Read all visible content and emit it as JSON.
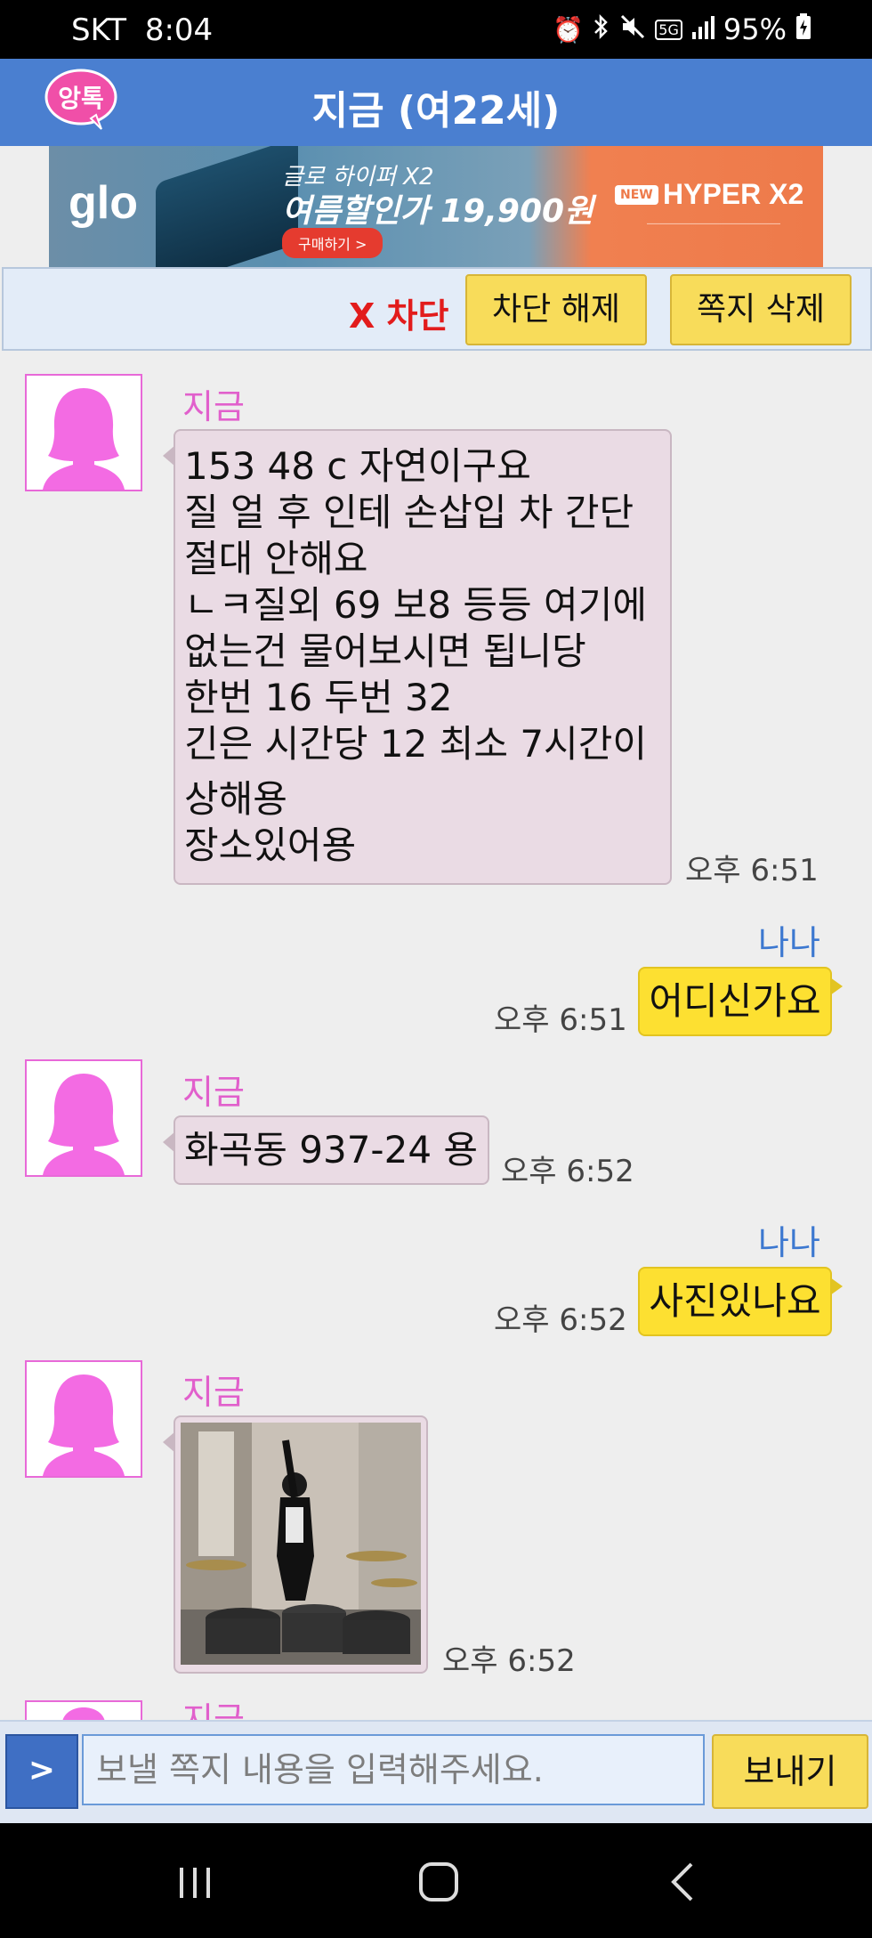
{
  "status_bar": {
    "carrier": "SKT",
    "time": "8:04",
    "network": "5G",
    "battery": "95%",
    "icons": [
      "alarm-icon",
      "bluetooth-icon",
      "mute-icon",
      "network-5g-icon",
      "signal-icon",
      "battery-charging-icon"
    ]
  },
  "header": {
    "logo_text": "앙톡",
    "title": "지금 (여22세)"
  },
  "ad": {
    "brand_logo": "glo",
    "line1": "글로 하이퍼 X2",
    "line2": "여름할인가 19,900원",
    "cta": "구매하기 >",
    "badge": "NEW",
    "product": "HYPER X2"
  },
  "actions": {
    "block": "X 차단",
    "unblock": "차단 해제",
    "delete": "쪽지 삭제"
  },
  "messages": [
    {
      "direction": "in",
      "sender": "지금",
      "lines": [
        "153 48 c 자연이구요",
        "질 얼 후 인테 손삽입 차 간단",
        "절대 안해요",
        "ㄴㅋ질외 69 보8 등등 여기에",
        "없는건 물어보시면 됩니당",
        "한번 16 두번 32",
        "긴은 시간당 12 최소 7시간이",
        "상해용",
        "장소있어용"
      ],
      "time": "오후 6:51"
    },
    {
      "direction": "out",
      "sender": "나나",
      "text": "어디신가요",
      "time": "오후 6:51"
    },
    {
      "direction": "in",
      "sender": "지금",
      "lines": [
        "화곡동 937-24 용"
      ],
      "time": "오후 6:52"
    },
    {
      "direction": "out",
      "sender": "나나",
      "text": "사진있나요",
      "time": "오후 6:52"
    },
    {
      "direction": "in",
      "sender": "지금",
      "image": "photo-of-woman-with-drum-kit",
      "time": "오후 6:52"
    },
    {
      "direction": "in",
      "sender": "지금",
      "partial": true
    }
  ],
  "composer": {
    "toggle": ">",
    "placeholder": "보낼 쪽지 내용을 입력해주세요.",
    "send": "보내기"
  },
  "nav": [
    "recent-apps-icon",
    "home-icon",
    "back-icon"
  ],
  "colors": {
    "header": "#4a7fd0",
    "sender_in": "#e160cc",
    "sender_out": "#3c78d0",
    "bubble_in": "#eadbe4",
    "bubble_out": "#fde031",
    "button": "#f8dc5a",
    "block": "#e21c1c"
  }
}
